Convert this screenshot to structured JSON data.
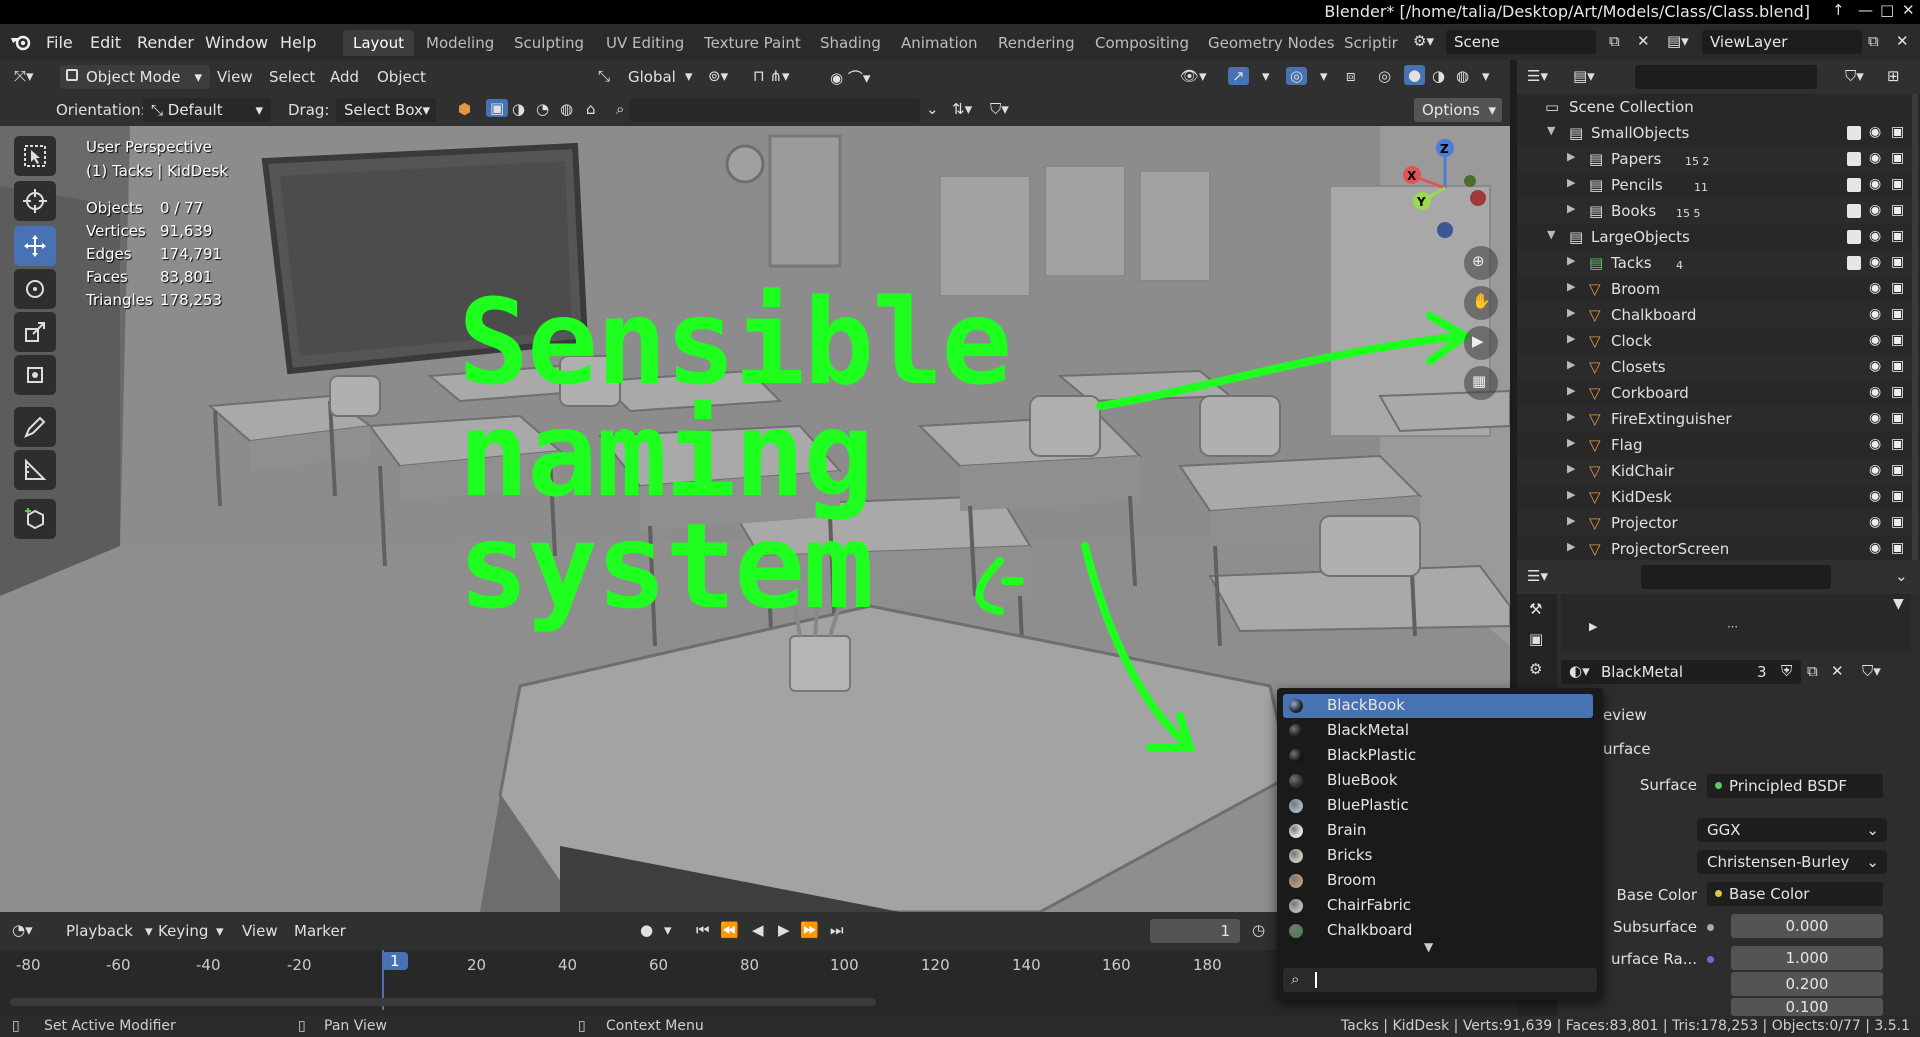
{
  "window": {
    "title": "Blender* [/home/talia/Desktop/Art/Models/Class/Class.blend]"
  },
  "menu": {
    "items": [
      "File",
      "Edit",
      "Render",
      "Window",
      "Help"
    ]
  },
  "workspaces": [
    "Layout",
    "Modeling",
    "Sculpting",
    "UV Editing",
    "Texture Paint",
    "Shading",
    "Animation",
    "Rendering",
    "Compositing",
    "Geometry Nodes",
    "Scriptir"
  ],
  "scene": {
    "name": "Scene",
    "view_layer": "ViewLayer"
  },
  "viewport_header": {
    "mode": "Object Mode",
    "menus": [
      "View",
      "Select",
      "Add",
      "Object"
    ],
    "transform": "Global",
    "orientation_label": "Orientation:",
    "orientation_value": "Default",
    "drag_label": "Drag:",
    "drag_value": "Select Box",
    "options": "Options"
  },
  "viewport_info": {
    "perspective": "User Perspective",
    "context": "(1) Tacks | KidDesk",
    "stats": [
      {
        "label": "Objects",
        "value": "0 / 77"
      },
      {
        "label": "Vertices",
        "value": "91,639"
      },
      {
        "label": "Edges",
        "value": "174,791"
      },
      {
        "label": "Faces",
        "value": "83,801"
      },
      {
        "label": "Triangles",
        "value": "178,253"
      }
    ],
    "overlay_text": [
      "Sensible",
      "naming",
      "system"
    ],
    "overlay_color": "#1fff1f"
  },
  "outliner": {
    "root": "Scene Collection",
    "rows": [
      {
        "name": "SmallObjects",
        "kind": "collection",
        "checkbox": true,
        "badge": ""
      },
      {
        "name": "Papers",
        "kind": "collection",
        "checkbox": true,
        "badge": "15 2"
      },
      {
        "name": "Pencils",
        "kind": "collection",
        "checkbox": true,
        "badge": "11"
      },
      {
        "name": "Books",
        "kind": "collection",
        "checkbox": true,
        "badge": "15 5"
      },
      {
        "name": "LargeObjects",
        "kind": "collection",
        "checkbox": true,
        "badge": ""
      },
      {
        "name": "Tacks",
        "kind": "collection",
        "checkbox": true,
        "badge": "4"
      },
      {
        "name": "Broom",
        "kind": "object",
        "checkbox": false,
        "badge": ""
      },
      {
        "name": "Chalkboard",
        "kind": "object",
        "checkbox": false,
        "badge": ""
      },
      {
        "name": "Clock",
        "kind": "object",
        "checkbox": false,
        "badge": ""
      },
      {
        "name": "Closets",
        "kind": "object",
        "checkbox": false,
        "badge": ""
      },
      {
        "name": "Corkboard",
        "kind": "object",
        "checkbox": false,
        "badge": ""
      },
      {
        "name": "FireExtinguisher",
        "kind": "object",
        "checkbox": false,
        "badge": ""
      },
      {
        "name": "Flag",
        "kind": "object",
        "checkbox": false,
        "badge": ""
      },
      {
        "name": "KidChair",
        "kind": "object",
        "checkbox": false,
        "badge": ""
      },
      {
        "name": "KidDesk",
        "kind": "object",
        "checkbox": false,
        "badge": ""
      },
      {
        "name": "Projector",
        "kind": "object",
        "checkbox": false,
        "badge": ""
      },
      {
        "name": "ProjectorScreen",
        "kind": "object",
        "checkbox": false,
        "badge": ""
      }
    ]
  },
  "properties": {
    "material_name": "BlackMetal",
    "material_users": "3",
    "sections": [
      "eview",
      "urface"
    ],
    "surface_label": "Surface",
    "surface_value": "Principled BSDF",
    "distribution": "GGX",
    "subsurface_method": "Christensen-Burley",
    "base_color_label": "Base Color",
    "base_color_value": "Base Color",
    "subsurface_label": "Subsurface",
    "subsurface_value": "0.000",
    "subsurface_radius_label": "urface Ra...",
    "radius_values": [
      "1.000",
      "0.200",
      "0.100"
    ]
  },
  "material_dropdown": {
    "items": [
      {
        "name": "BlackBook",
        "color": "#222222",
        "selected": true
      },
      {
        "name": "BlackMetal",
        "color": "#1a1a1a",
        "selected": false
      },
      {
        "name": "BlackPlastic",
        "color": "#151515",
        "selected": false
      },
      {
        "name": "BlueBook",
        "color": "#2b2f3a",
        "selected": false
      },
      {
        "name": "BluePlastic",
        "color": "#9fb4bf",
        "selected": false
      },
      {
        "name": "Brain",
        "color": "#e4e0d8",
        "selected": false
      },
      {
        "name": "Bricks",
        "color": "#c9c4bb",
        "selected": false
      },
      {
        "name": "Broom",
        "color": "#b59a77",
        "selected": false
      },
      {
        "name": "ChairFabric",
        "color": "#b8b8b8",
        "selected": false
      },
      {
        "name": "Chalkboard",
        "color": "#4f7d55",
        "selected": false
      }
    ]
  },
  "timeline": {
    "menus": [
      "Playback",
      "Keying",
      "View",
      "Marker"
    ],
    "current_frame": "1",
    "ticks": [
      "-80",
      "-60",
      "-40",
      "-20",
      "1",
      "20",
      "40",
      "60",
      "80",
      "100",
      "120",
      "140",
      "160",
      "180"
    ]
  },
  "statusbar": {
    "left": [
      "Set Active Modifier",
      "Pan View",
      "Context Menu"
    ],
    "right": "Tacks | KidDesk | Verts:91,639 | Faces:83,801 | Tris:178,253 | Objects:0/77 | 3.5.1"
  },
  "colors": {
    "accent": "#4772b3",
    "overlay_green": "#1fff1f",
    "orange_mesh": "#e69545",
    "collection_white": "#dddddd",
    "collection_green": "#5fc85f"
  }
}
